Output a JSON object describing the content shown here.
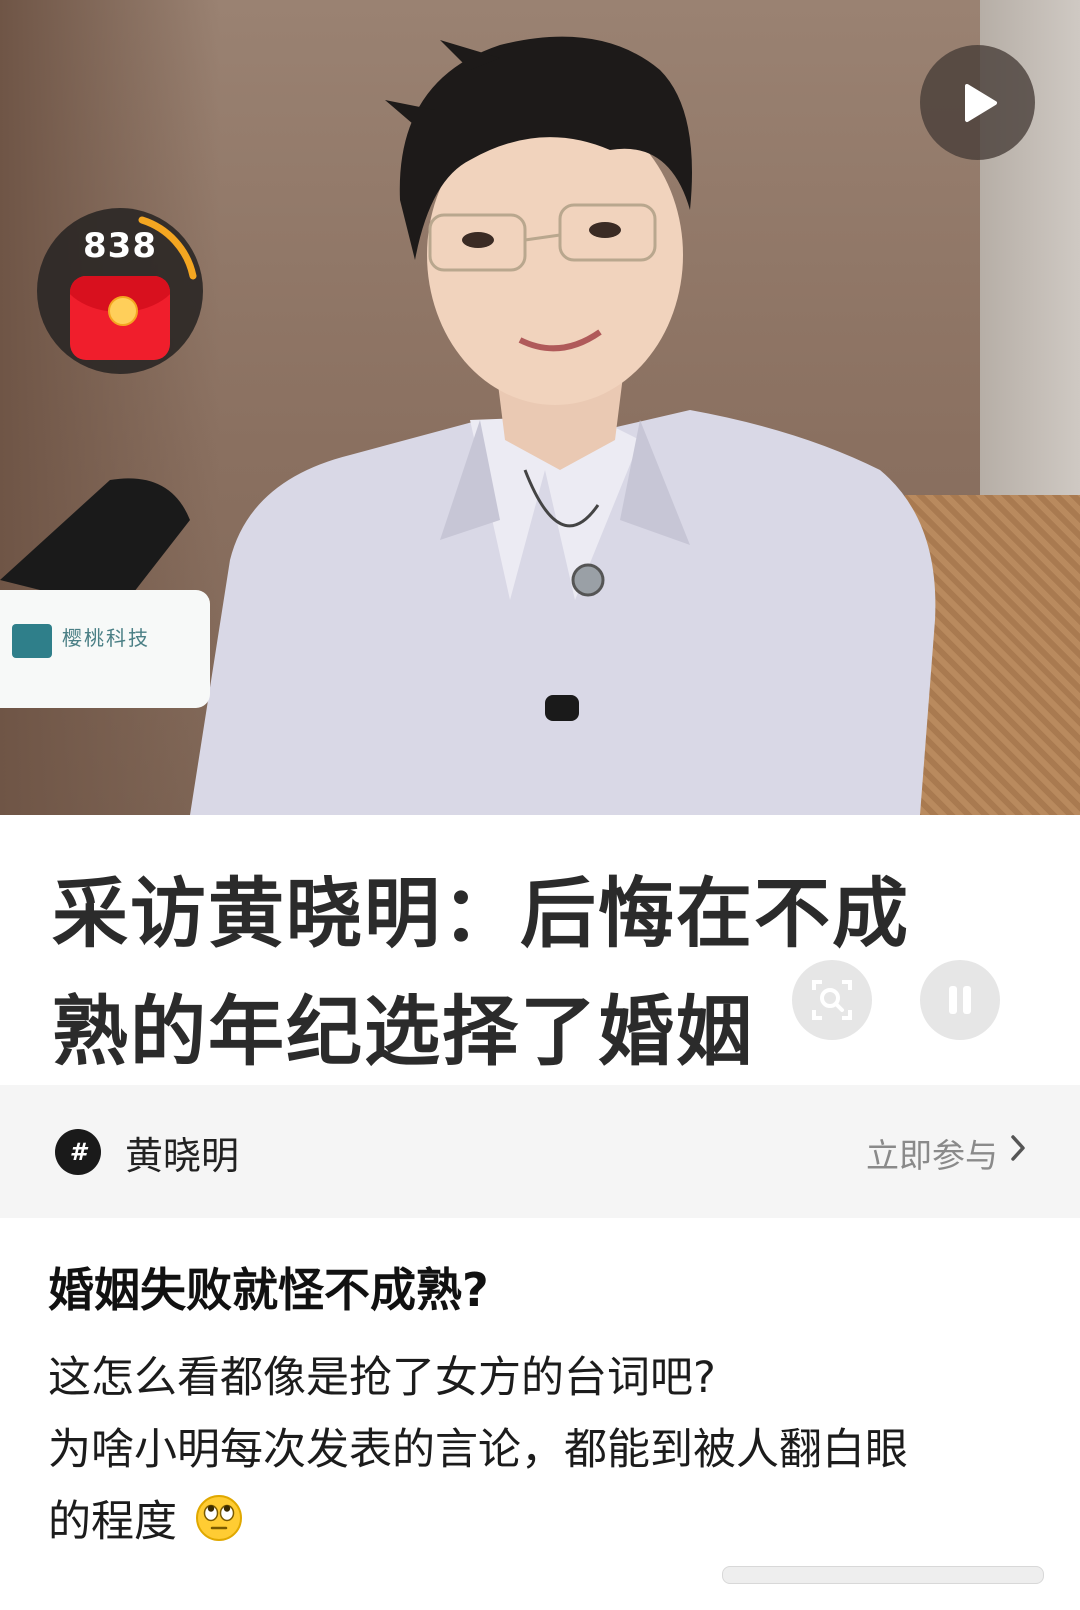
{
  "video": {
    "red_packet_count": "838",
    "mic_brand": "樱桃科技",
    "icons": [
      "play-icon",
      "red-packet-icon"
    ]
  },
  "headline": {
    "line1": "采访黄晓明：后悔在不成",
    "line2": "熟的年纪选择了婚姻",
    "controls": [
      "search-icon",
      "pause-icon"
    ]
  },
  "topic": {
    "name": "黄晓明",
    "action_label": "立即参与",
    "icon": "hashtag-icon"
  },
  "post": {
    "title": "婚姻失败就怪不成熟?",
    "lines": [
      "这怎么看都像是抢了女方的台词吧?",
      "为啥小明每次发表的言论，都能到被人翻白眼",
      "的程度"
    ],
    "emoji": "eye-roll-emoji"
  },
  "colors": {
    "red_packet": "#f01e2c",
    "ring": "#f4a621",
    "topic_bg": "#f5f5f5"
  }
}
